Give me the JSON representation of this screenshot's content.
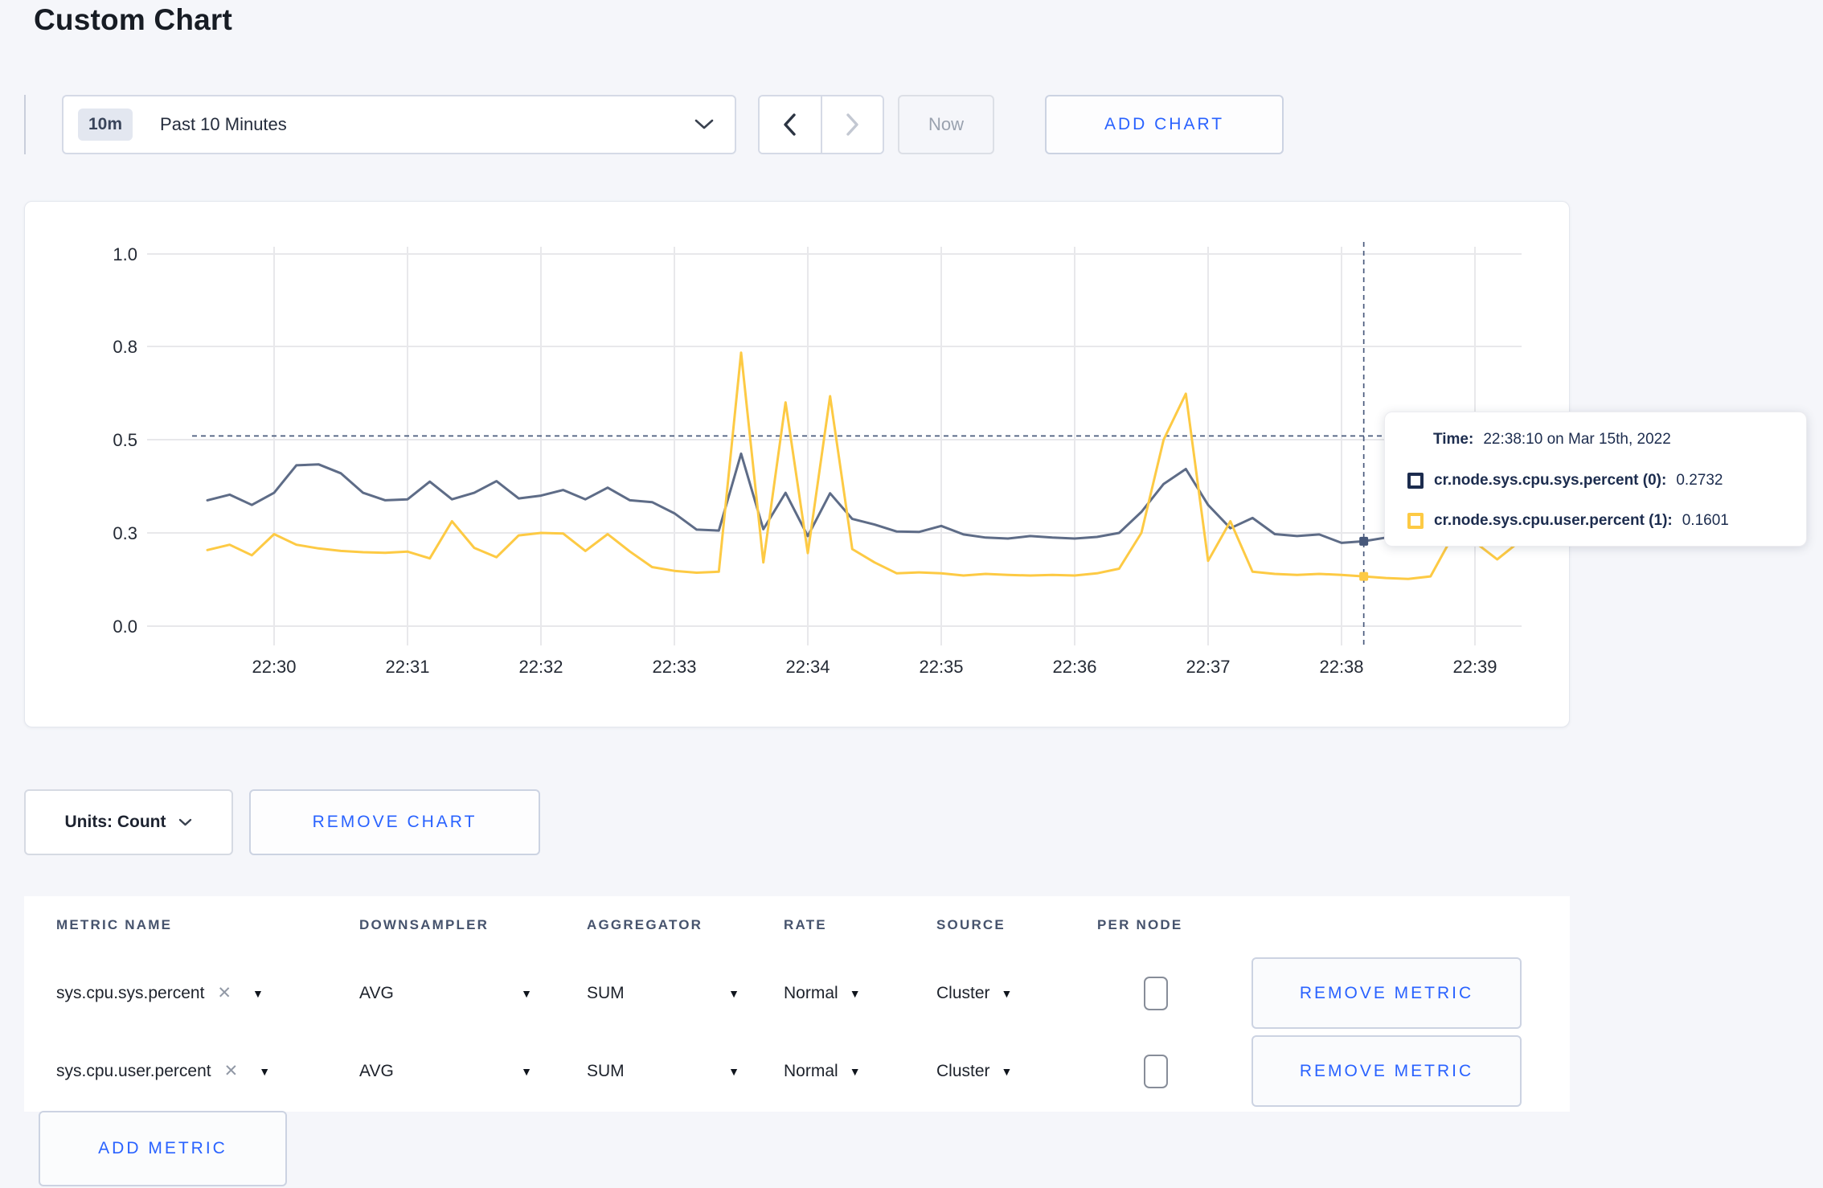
{
  "page": {
    "title": "Custom Chart"
  },
  "toolbar": {
    "time_window_badge": "10m",
    "time_window_label": "Past 10 Minutes",
    "now_label": "Now",
    "add_chart_label": "ADD CHART"
  },
  "chart_data": {
    "type": "line",
    "title": "",
    "xlabel": "",
    "ylabel": "",
    "ylim": [
      0,
      1
    ],
    "grid": true,
    "y_ticks": [
      "0.0",
      "0.3",
      "0.5",
      "0.8",
      "1.0"
    ],
    "x_ticks": [
      "22:30",
      "22:31",
      "22:32",
      "22:33",
      "22:34",
      "22:35",
      "22:36",
      "22:37",
      "22:38",
      "22:39"
    ],
    "x": [
      "22:29:30",
      "22:29:40",
      "22:29:50",
      "22:30:00",
      "22:30:10",
      "22:30:20",
      "22:30:30",
      "22:30:40",
      "22:30:50",
      "22:31:00",
      "22:31:10",
      "22:31:20",
      "22:31:30",
      "22:31:40",
      "22:31:50",
      "22:32:00",
      "22:32:10",
      "22:32:20",
      "22:32:30",
      "22:32:40",
      "22:32:50",
      "22:33:00",
      "22:33:10",
      "22:33:20",
      "22:33:30",
      "22:33:40",
      "22:33:50",
      "22:34:00",
      "22:34:10",
      "22:34:20",
      "22:34:30",
      "22:34:40",
      "22:34:50",
      "22:35:00",
      "22:35:10",
      "22:35:20",
      "22:35:30",
      "22:35:40",
      "22:35:50",
      "22:36:00",
      "22:36:10",
      "22:36:20",
      "22:36:30",
      "22:36:40",
      "22:36:50",
      "22:37:00",
      "22:37:10",
      "22:37:20",
      "22:37:30",
      "22:37:40",
      "22:37:50",
      "22:38:00",
      "22:38:10",
      "22:38:20",
      "22:38:30",
      "22:38:40",
      "22:38:50",
      "22:39:00",
      "22:39:10",
      "22:39:20"
    ],
    "series": [
      {
        "name": "cr.node.sys.cpu.sys.percent",
        "color": "#5e6c87",
        "values": [
          0.37,
          0.382,
          0.36,
          0.386,
          0.445,
          0.447,
          0.428,
          0.386,
          0.37,
          0.372,
          0.41,
          0.372,
          0.386,
          0.411,
          0.374,
          0.38,
          0.392,
          0.372,
          0.397,
          0.37,
          0.366,
          0.342,
          0.307,
          0.305,
          0.47,
          0.308,
          0.386,
          0.29,
          0.385,
          0.33,
          0.318,
          0.303,
          0.302,
          0.315,
          0.295,
          0.285,
          0.282,
          0.29,
          0.285,
          0.282,
          0.287,
          0.3,
          0.345,
          0.405,
          0.437,
          0.36,
          0.31,
          0.332,
          0.296,
          0.29,
          0.295,
          0.268,
          0.2732,
          0.285,
          0.3,
          0.31,
          0.3,
          0.303,
          0.306,
          0.31
        ]
      },
      {
        "name": "cr.node.sys.cpu.user.percent",
        "color": "#fdca44",
        "values": [
          0.245,
          0.262,
          0.228,
          0.296,
          0.262,
          0.25,
          0.242,
          0.238,
          0.236,
          0.24,
          0.218,
          0.325,
          0.252,
          0.222,
          0.292,
          0.3,
          0.298,
          0.242,
          0.296,
          0.24,
          0.19,
          0.178,
          0.172,
          0.175,
          0.78,
          0.205,
          0.62,
          0.235,
          0.64,
          0.248,
          0.205,
          0.17,
          0.173,
          0.17,
          0.163,
          0.168,
          0.165,
          0.163,
          0.165,
          0.163,
          0.17,
          0.185,
          0.3,
          0.5,
          0.648,
          0.21,
          0.325,
          0.175,
          0.168,
          0.165,
          0.168,
          0.165,
          0.1601,
          0.155,
          0.152,
          0.16,
          0.29,
          0.27,
          0.215,
          0.272
        ]
      }
    ],
    "crosshair": {
      "time": "22:38:10",
      "y_value": 0.512
    },
    "legend_position": "tooltip"
  },
  "tooltip": {
    "time_label": "Time:",
    "time_value": "22:38:10 on Mar 15th, 2022",
    "rows": [
      {
        "name": "cr.node.sys.cpu.sys.percent (0):",
        "value": "0.2732",
        "color": "#1c2c4e"
      },
      {
        "name": "cr.node.sys.cpu.user.percent (1):",
        "value": "0.1601",
        "color": "#fdca44"
      }
    ]
  },
  "chart_actions": {
    "units_label": "Units: Count",
    "remove_chart_label": "REMOVE CHART"
  },
  "metric_table": {
    "headers": [
      "METRIC NAME",
      "DOWNSAMPLER",
      "AGGREGATOR",
      "RATE",
      "SOURCE",
      "PER NODE"
    ],
    "rows": [
      {
        "metric": "sys.cpu.sys.percent",
        "downsampler": "AVG",
        "aggregator": "SUM",
        "rate": "Normal",
        "source": "Cluster",
        "per_node_checked": false,
        "remove_label": "REMOVE METRIC"
      },
      {
        "metric": "sys.cpu.user.percent",
        "downsampler": "AVG",
        "aggregator": "SUM",
        "rate": "Normal",
        "source": "Cluster",
        "per_node_checked": false,
        "remove_label": "REMOVE METRIC"
      }
    ],
    "add_metric_label": "ADD METRIC"
  },
  "icons": {
    "time_dropdown": "chevron-down-icon",
    "prev": "chevron-left-icon",
    "next": "chevron-right-icon",
    "metric_remove": "x-icon",
    "select_caret": "caret-down-icon"
  },
  "colors": {
    "accent_blue": "#2962ff",
    "series_sys": "#5e6c87",
    "series_user": "#fdca44",
    "tooltip_text": "#1c2c4e",
    "crosshair": "#4a5b7d",
    "page_bg": "#f5f6fa",
    "gridline": "#e8e8eb"
  }
}
